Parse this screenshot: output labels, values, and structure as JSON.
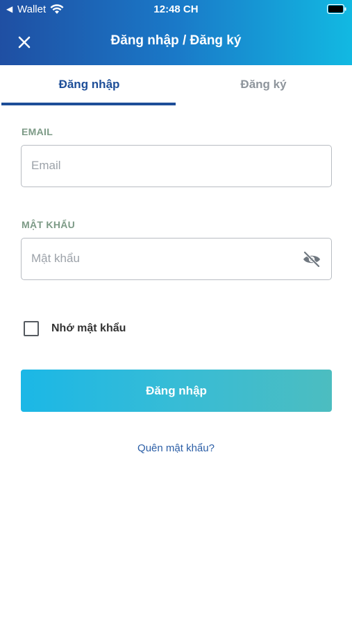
{
  "status_bar": {
    "back_glyph": "◀",
    "carrier": "Wallet",
    "time": "12:48 CH",
    "icons": [
      "wifi-icon",
      "alarm-dot",
      "battery-icon"
    ]
  },
  "header": {
    "title": "Đăng nhập / Đăng ký",
    "close_icon": "close-icon",
    "gradient": [
      "#1f4fa3",
      "#12b9e2"
    ]
  },
  "tabs": [
    {
      "label": "Đăng nhập",
      "active": true
    },
    {
      "label": "Đăng ký",
      "active": false
    }
  ],
  "form": {
    "email": {
      "label": "EMAIL",
      "placeholder": "Email",
      "value": ""
    },
    "password": {
      "label": "MẬT KHẨU",
      "placeholder": "Mật khẩu",
      "value": "",
      "toggle_icon": "eye-off-icon"
    },
    "remember": {
      "label": "Nhớ mật khẩu",
      "checked": false
    },
    "submit_label": "Đăng nhập",
    "forgot_label": "Quên mật khẩu?"
  },
  "colors": {
    "accent": "#1d4e98",
    "label": "#7c9a86",
    "button": "#1bb7e6"
  }
}
